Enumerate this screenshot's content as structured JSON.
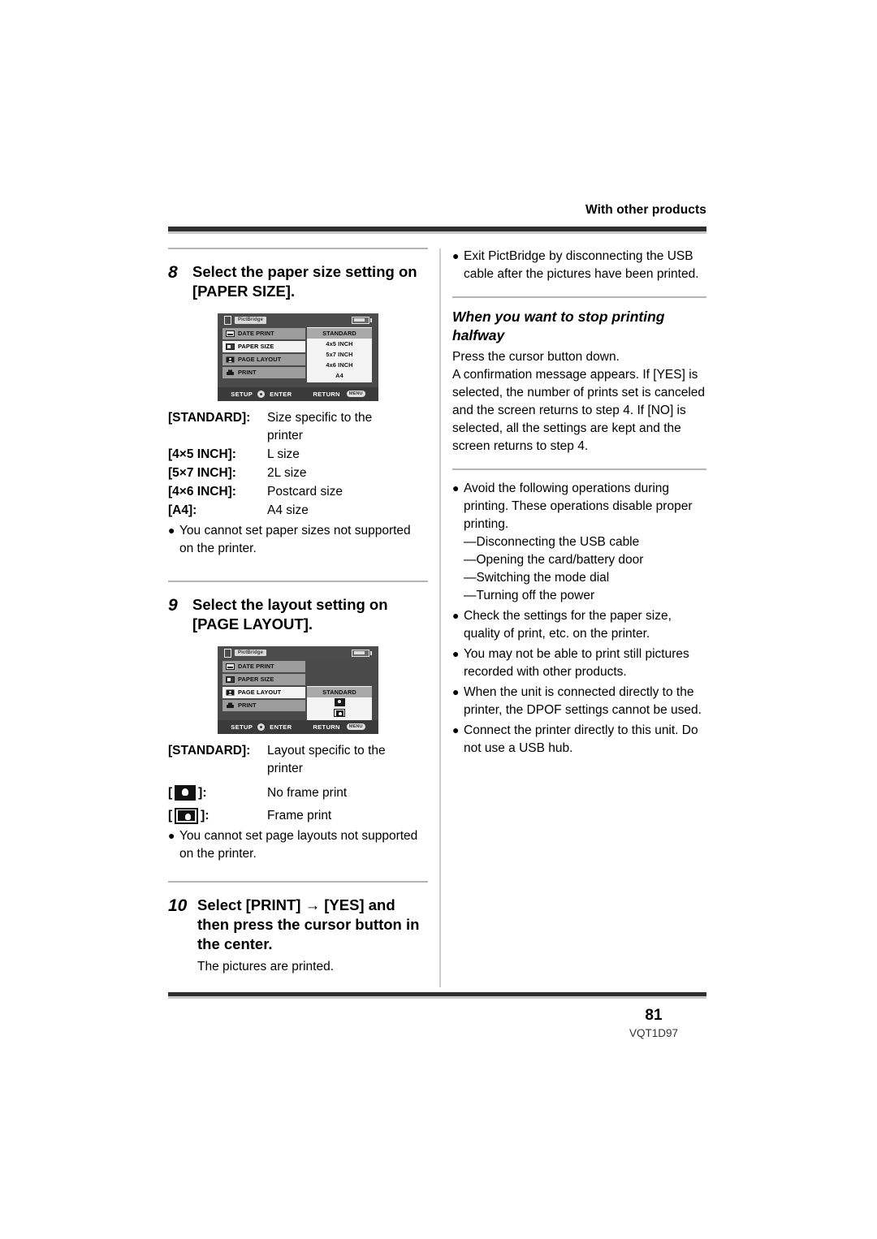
{
  "header": {
    "running_head": "With other products"
  },
  "footer": {
    "page_number": "81",
    "doc_code": "VQT1D97"
  },
  "left_column": {
    "step8": {
      "number": "8",
      "title": "Select the paper size setting on [PAPER SIZE].",
      "screen": {
        "top_bar": {
          "page_icon": "page-icon",
          "badge": "PictBridge",
          "battery_icon": "battery-icon"
        },
        "menu_items": [
          {
            "label": "DATE PRINT",
            "icon": "date-print-icon",
            "selected": false
          },
          {
            "label": "PAPER SIZE",
            "icon": "paper-size-icon",
            "selected": true
          },
          {
            "label": "PAGE LAYOUT",
            "icon": "page-layout-icon",
            "selected": false
          },
          {
            "label": "PRINT",
            "icon": "printer-icon",
            "selected": false
          }
        ],
        "options": [
          {
            "label": "STANDARD",
            "selected": true
          },
          {
            "label": "4x5 INCH",
            "selected": false
          },
          {
            "label": "5x7 INCH",
            "selected": false
          },
          {
            "label": "4x6 INCH",
            "selected": false
          },
          {
            "label": "A4",
            "selected": false
          }
        ],
        "bottom_bar": {
          "setup_label": "SETUP",
          "enter_label": "ENTER",
          "return_label": "RETURN",
          "menu_badge": "MENU"
        }
      },
      "definitions": [
        {
          "term": "[STANDARD]:",
          "desc": "Size specific to the",
          "desc2": "printer"
        },
        {
          "term": "[4×5 INCH]:",
          "desc": "L size"
        },
        {
          "term": "[5×7 INCH]:",
          "desc": "2L size"
        },
        {
          "term": "[4×6 INCH]:",
          "desc": "Postcard size"
        },
        {
          "term": "[A4]:",
          "desc": "A4 size"
        }
      ],
      "note": "You cannot set paper sizes not supported on the printer."
    },
    "step9": {
      "number": "9",
      "title": "Select the layout setting on [PAGE LAYOUT].",
      "screen": {
        "top_bar": {
          "page_icon": "page-icon",
          "badge": "PictBridge",
          "battery_icon": "battery-icon"
        },
        "menu_items": [
          {
            "label": "DATE PRINT",
            "icon": "date-print-icon",
            "selected": false
          },
          {
            "label": "PAPER SIZE",
            "icon": "paper-size-icon",
            "selected": false
          },
          {
            "label": "PAGE LAYOUT",
            "icon": "page-layout-icon",
            "selected": true
          },
          {
            "label": "PRINT",
            "icon": "printer-icon",
            "selected": false
          }
        ],
        "options": [
          {
            "label": "STANDARD",
            "selected": true
          },
          {
            "label": "",
            "icon": "no-frame-print-icon",
            "selected": false
          },
          {
            "label": "",
            "icon": "frame-print-icon",
            "selected": false
          }
        ],
        "bottom_bar": {
          "setup_label": "SETUP",
          "enter_label": "ENTER",
          "return_label": "RETURN",
          "menu_badge": "MENU"
        }
      },
      "definitions": [
        {
          "term": "[STANDARD]:",
          "desc": "Layout specific to the",
          "desc2": "printer"
        }
      ],
      "icon_definitions": [
        {
          "icon": "no-frame-print-icon",
          "desc": "No frame print"
        },
        {
          "icon": "frame-print-icon",
          "desc": "Frame print"
        }
      ],
      "note": "You cannot set page layouts not supported on the printer."
    },
    "step10": {
      "number": "10",
      "title": "Select [PRINT] → [YES] and then press the cursor button in the center.",
      "body": "The pictures are printed."
    }
  },
  "right_column": {
    "top_bullet": "Exit PictBridge by disconnecting the USB cable after the pictures have been printed.",
    "section": {
      "heading": "When you want to stop printing halfway",
      "paragraph1": "Press the cursor button down.",
      "paragraph2": "A confirmation message appears. If [YES] is selected, the number of prints set is canceled and the screen returns to step 4. If [NO] is selected, all the settings are kept and the screen returns to step 4."
    },
    "bullets": [
      {
        "text": "Avoid the following operations during printing. These operations disable proper printing.",
        "subitems": [
          "Disconnecting the USB cable",
          "Opening the card/battery door",
          "Switching the mode dial",
          "Turning off the power"
        ]
      },
      {
        "text": "Check the settings for the paper size, quality of print, etc. on the printer."
      },
      {
        "text": "You may not be able to print still pictures recorded with other products."
      },
      {
        "text": "When the unit is connected directly to the printer, the DPOF settings cannot be used."
      },
      {
        "text": "Connect the printer directly to this unit. Do not use a USB hub."
      }
    ]
  },
  "colors": {
    "rule_dark": "#2f2f2f",
    "rule_light": "#c9c9c9",
    "lcd_bg": "#4a4a4a",
    "lcd_row": "#9d9d9d",
    "lcd_selected": "#f4f4f4"
  }
}
